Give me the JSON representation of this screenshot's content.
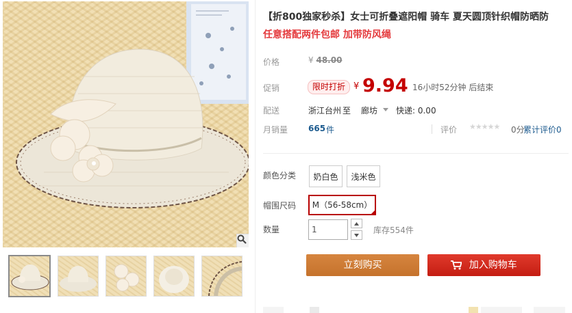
{
  "product": {
    "title": "【折800独家秒杀】女士可折叠遮阳帽 骑车 夏天圆顶针织帽防晒防",
    "subtitle": "任意搭配两件包邮 加带防风绳"
  },
  "price": {
    "label": "价格",
    "original_symbol": "¥",
    "original": "48.00"
  },
  "promo": {
    "label": "促销",
    "badge": "限时打折",
    "symbol": "¥",
    "price": "9.94",
    "countdown": "16小时52分钟 后结束"
  },
  "shipping": {
    "label": "配送",
    "from": "浙江台州",
    "to_word": "至",
    "destination": "廊坊",
    "fee": "快递: 0.00"
  },
  "sales": {
    "label": "月销量",
    "count": "665",
    "unit": "件",
    "rating_label": "评价",
    "stars": "★★★★★",
    "rating_value": "0分",
    "reviews_link": "累计评价0"
  },
  "options": {
    "color_label": "颜色分类",
    "colors": [
      "奶白色",
      "浅米色"
    ],
    "size_label": "帽围尺码",
    "size_selected": "M（56-58cm）",
    "qty_label": "数量",
    "qty_value": "1",
    "stock": "库存554件"
  },
  "actions": {
    "buy": "立刻购买",
    "cart": "加入购物车"
  },
  "colors": {
    "accent_red": "#c40000",
    "buy_orange": "#cd7a35",
    "cart_red": "#d22b1f",
    "link_blue": "#1d5b8f"
  },
  "icons": {
    "zoom": "magnifier-icon",
    "cart": "shopping-cart-icon",
    "qty_up": "triangle-up-icon",
    "qty_down": "triangle-down-icon"
  }
}
